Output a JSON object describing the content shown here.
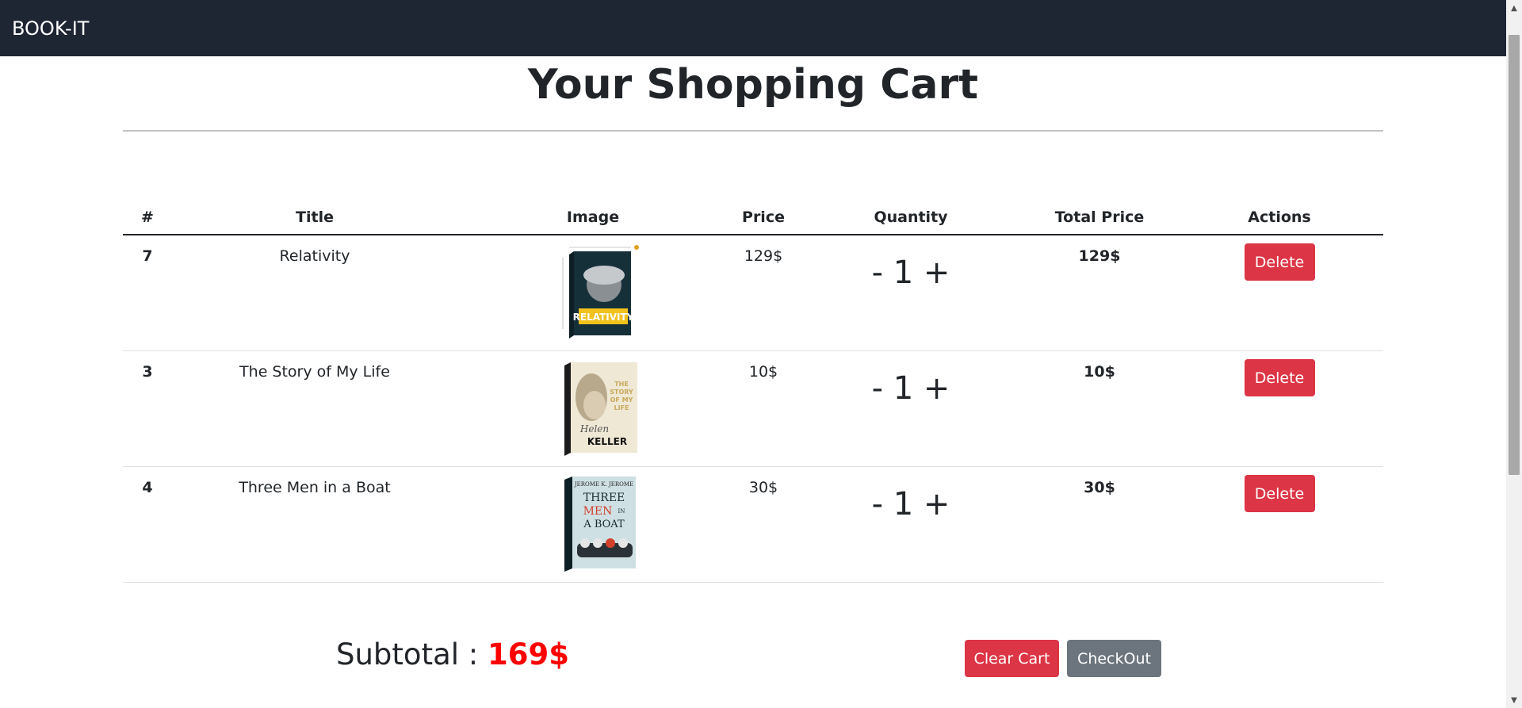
{
  "navbar": {
    "brand": "BOOK-IT"
  },
  "page": {
    "title": "Your Shopping Cart"
  },
  "table": {
    "headers": [
      "#",
      "Title",
      "Image",
      "Price",
      "Quantity",
      "Total Price",
      "Actions"
    ],
    "rows": [
      {
        "id": "7",
        "title": "Relativity",
        "price": "129$",
        "quantity": "1",
        "total": "129$",
        "delete_label": "Delete",
        "cover": {
          "title_text": "RELATIVITY",
          "color": "#16303a"
        }
      },
      {
        "id": "3",
        "title": "The Story of My Life",
        "price": "10$",
        "quantity": "1",
        "total": "10$",
        "delete_label": "Delete",
        "cover": {
          "title_lines": [
            "THE",
            "STORY",
            "OF MY",
            "LIFE"
          ],
          "script": "Helen",
          "author": "KELLER",
          "color": "#efe8d5"
        }
      },
      {
        "id": "4",
        "title": "Three Men in a Boat",
        "price": "30$",
        "quantity": "1",
        "total": "30$",
        "delete_label": "Delete",
        "cover": {
          "author": "JEROME K. JEROME",
          "title_lines": [
            "THREE",
            "MEN",
            "A BOAT"
          ],
          "title_in": "IN",
          "color": "#cfe0e5"
        }
      }
    ],
    "minus": "-",
    "plus": "+"
  },
  "subtotal": {
    "label": "Subtotal :",
    "value": "169$"
  },
  "buttons": {
    "clear_cart": "Clear Cart",
    "checkout": "CheckOut"
  },
  "colors": {
    "navbar": "#1e2533",
    "danger": "#dc3545",
    "secondary": "#6c757d",
    "subtotal": "#ff0000"
  }
}
